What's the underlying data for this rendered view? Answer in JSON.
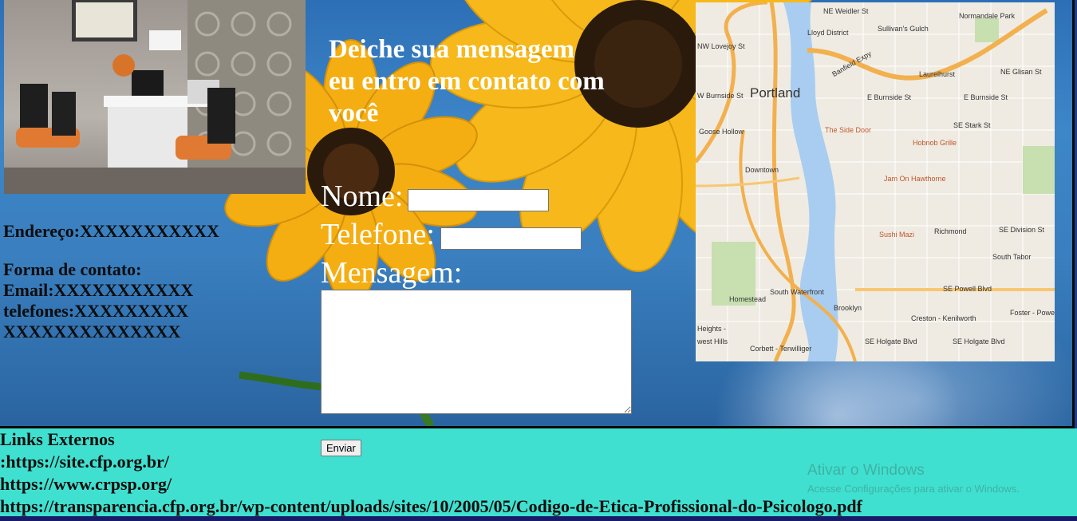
{
  "heading": {
    "line1": "Deiche sua mensagem",
    "line2": "eu entro em contato com",
    "line3": "você"
  },
  "info": {
    "address": "Endereço:XXXXXXXXXXX",
    "contact_title": "Forma de contato:",
    "email": "Email:XXXXXXXXXXX",
    "phones": "telefones:XXXXXXXXX",
    "phones2": "XXXXXXXXXXXXXX"
  },
  "form": {
    "name_label": "Nome:",
    "name_value": "",
    "phone_label": "Telefone:",
    "phone_value": "",
    "message_label": "Mensagem:",
    "message_value": "",
    "submit_label": "Enviar"
  },
  "map": {
    "city": "Portland",
    "labels": {
      "ne_weidler": "NE Weidler St",
      "lloyd": "Lloyd District",
      "sullivans": "Sullivan's Gulch",
      "normandale": "Normandale Park",
      "nw_lovejoy": "NW Lovejoy St",
      "banfield": "Banfield Expy",
      "laurelhurst": "Laurelhurst",
      "ne_glisan": "NE Glisan St",
      "e_burnside": "E Burnside St",
      "e_burnside2": "E Burnside St",
      "sw_burnside": "W Burnside St",
      "goose": "Goose Hollow",
      "side_door": "The Side Door",
      "se_stark": "SE Stark St",
      "hobnob": "Hobnob Grille",
      "downtown": "Downtown",
      "jam": "Jam On Hawthorne",
      "sushi": "Sushi Mazi",
      "richmond": "Richmond",
      "se_division": "SE Division St",
      "south_tabor": "South Tabor",
      "south_waterfront": "South Waterfront",
      "homestead": "Homestead",
      "brooklyn": "Brooklyn",
      "se_powell": "SE Powell Blvd",
      "creston": "Creston - Kenilworth",
      "foster": "Foster - Powe",
      "heights": "Heights -",
      "west_hills": "west Hills",
      "corbett": "Corbett - Terwilliger",
      "se_holgate": "SE Holgate Blvd",
      "se_holgate2": "SE Holgate Blvd"
    }
  },
  "footer": {
    "links_title": "Links Externos",
    "link1": ":https://site.cfp.org.br/",
    "link2": "https://www.crpsp.org/",
    "link3": "https://transparencia.cfp.org.br/wp-content/uploads/sites/10/2005/05/Codigo-de-Etica-Profissional-do-Psicologo.pdf"
  },
  "watermark": {
    "title": "Ativar o Windows",
    "subtitle": "Acesse Configurações para ativar o Windows."
  },
  "colors": {
    "footer_bg": "#40e0d0",
    "sky": "#3a7fbf",
    "petal": "#f6b81a"
  }
}
